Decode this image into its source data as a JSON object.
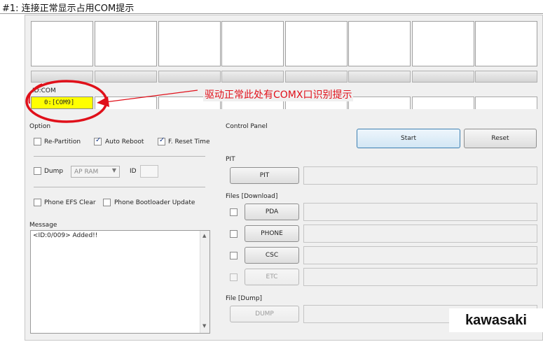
{
  "caption": {
    "text": "#1: 连接正常显示占用COM提示"
  },
  "idcom": {
    "label": "ID:COM",
    "port_value": "0:[COM9]"
  },
  "annotation": {
    "text": "驱动正常此处有COMX口识别提示"
  },
  "option": {
    "title": "Option",
    "re_partition": {
      "label": "Re-Partition",
      "checked": false
    },
    "auto_reboot": {
      "label": "Auto Reboot",
      "checked": true
    },
    "f_reset_time": {
      "label": "F. Reset Time",
      "checked": true
    },
    "dump": {
      "label": "Dump",
      "checked": false
    },
    "dump_select": {
      "value": "AP RAM"
    },
    "id_label": "ID",
    "phone_efs_clear": {
      "label": "Phone EFS Clear",
      "checked": false
    },
    "phone_bootloader_update": {
      "label": "Phone Bootloader Update",
      "checked": false
    }
  },
  "message": {
    "title": "Message",
    "log": "<ID:0/009> Added!!"
  },
  "control_panel": {
    "title": "Control Panel",
    "start_label": "Start",
    "reset_label": "Reset"
  },
  "pit": {
    "title": "PIT",
    "button_label": "PIT"
  },
  "files_download": {
    "title": "Files [Download]",
    "items": [
      {
        "label": "PDA",
        "enabled": true
      },
      {
        "label": "PHONE",
        "enabled": true
      },
      {
        "label": "CSC",
        "enabled": true
      },
      {
        "label": "ETC",
        "enabled": false
      }
    ]
  },
  "file_dump": {
    "title": "File [Dump]",
    "button_label": "DUMP"
  },
  "watermark": {
    "text": "kawasaki"
  },
  "colors": {
    "annotation_red": "#e0101a",
    "com_highlight": "#ffff00",
    "start_border": "#3c7fb1"
  }
}
